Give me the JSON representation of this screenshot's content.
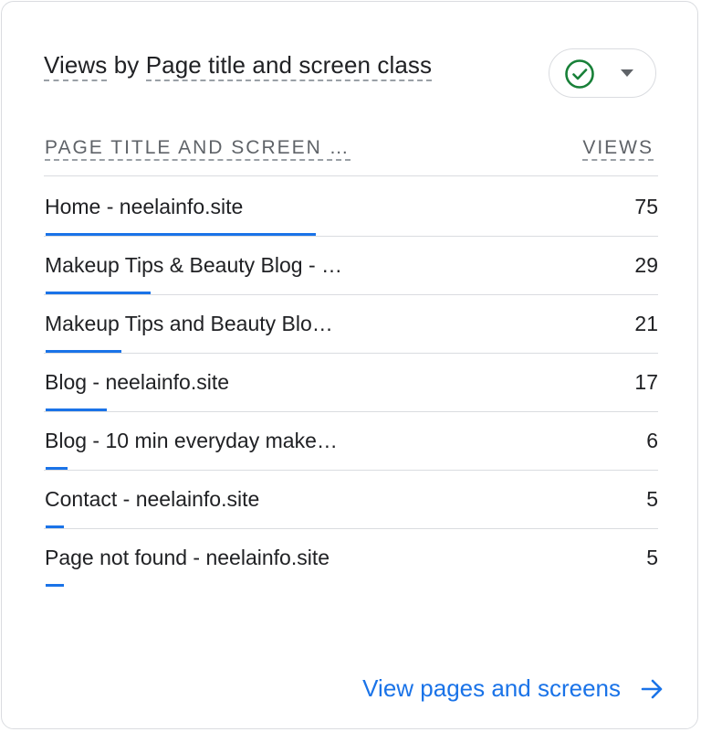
{
  "card": {
    "title_part1": "Views",
    "title_part2": " by ",
    "title_part3": "Page title and screen class",
    "compare_icon": "check-circle-icon",
    "compare_caret_icon": "caret-down-icon",
    "compare_color": "#188038"
  },
  "table": {
    "col_dimension": "PAGE TITLE AND SCREEN …",
    "col_metric": "VIEWS",
    "max_value": 75,
    "rows": [
      {
        "label": "Home - neelainfo.site",
        "value": "75",
        "share": 1.0
      },
      {
        "label": "Makeup Tips & Beauty Blog - …",
        "value": "29",
        "share": 0.387
      },
      {
        "label": "Makeup Tips and Beauty Blo…",
        "value": "21",
        "share": 0.28
      },
      {
        "label": "Blog - neelainfo.site",
        "value": "17",
        "share": 0.227
      },
      {
        "label": "Blog - 10 min everyday make…",
        "value": "6",
        "share": 0.08
      },
      {
        "label": "Contact - neelainfo.site",
        "value": "5",
        "share": 0.067
      },
      {
        "label": "Page not found - neelainfo.site",
        "value": "5",
        "share": 0.067
      }
    ]
  },
  "footer": {
    "link_label": "View pages and screens",
    "link_icon": "arrow-right-icon",
    "accent": "#1a73e8"
  }
}
